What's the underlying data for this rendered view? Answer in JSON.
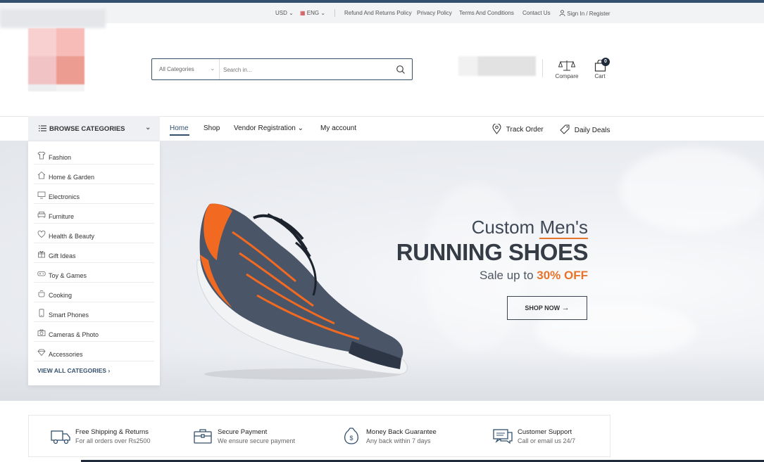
{
  "topbar": {
    "currency": "USD",
    "language": "ENG",
    "links": [
      "Refund And Returns Policy",
      "Privacy Policy",
      "Terms And Conditions",
      "Contact Us"
    ],
    "account": "Sign In / Register"
  },
  "search": {
    "category": "All Categories",
    "placeholder": "Search in..."
  },
  "header": {
    "compare_label": "Compare",
    "cart_label": "Cart",
    "cart_count": "0"
  },
  "nav": {
    "browse_label": "BROWSE CATEGORIES",
    "items": [
      "Home",
      "Shop",
      "Vendor Registration",
      "My account"
    ],
    "active": "Home",
    "track_order": "Track Order",
    "daily_deals": "Daily Deals"
  },
  "categories": {
    "items": [
      {
        "label": "Fashion",
        "icon": "tshirt-icon"
      },
      {
        "label": "Home & Garden",
        "icon": "home-icon"
      },
      {
        "label": "Electronics",
        "icon": "monitor-icon"
      },
      {
        "label": "Furniture",
        "icon": "sofa-icon"
      },
      {
        "label": "Health & Beauty",
        "icon": "heart-icon"
      },
      {
        "label": "Gift Ideas",
        "icon": "gift-icon"
      },
      {
        "label": "Toy & Games",
        "icon": "gamepad-icon"
      },
      {
        "label": "Cooking",
        "icon": "pot-icon"
      },
      {
        "label": "Smart Phones",
        "icon": "phone-icon"
      },
      {
        "label": "Cameras & Photo",
        "icon": "camera-icon"
      },
      {
        "label": "Accessories",
        "icon": "diamond-icon"
      }
    ],
    "view_all": "VIEW ALL CATEGORIES"
  },
  "hero": {
    "line1_a": "Custom ",
    "line1_b": "Men's",
    "line2": "RUNNING SHOES",
    "line3_a": "Sale up to ",
    "line3_b": "30% OFF",
    "button": "SHOP NOW",
    "accent_color": "#e8732b"
  },
  "features": [
    {
      "title": "Free Shipping & Returns",
      "subtitle": "For all orders over Rs2500",
      "icon": "truck-icon"
    },
    {
      "title": "Secure Payment",
      "subtitle": "We ensure secure payment",
      "icon": "briefcase-icon"
    },
    {
      "title": "Money Back Guarantee",
      "subtitle": "Any back within 7 days",
      "icon": "money-bag-icon"
    },
    {
      "title": "Customer Support",
      "subtitle": "Call or email us 24/7",
      "icon": "chat-icon"
    }
  ],
  "colors": {
    "brand": "#33506e",
    "dark": "#1f2b3a",
    "accent": "#e8732b"
  }
}
